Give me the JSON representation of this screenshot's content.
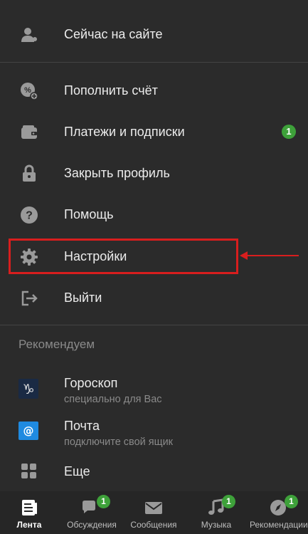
{
  "menu": {
    "online": "Сейчас на сайте",
    "topup": "Пополнить счёт",
    "payments": "Платежи и подписки",
    "payments_badge": "1",
    "privacy": "Закрыть профиль",
    "help": "Помощь",
    "settings": "Настройки",
    "logout": "Выйти"
  },
  "recommend": {
    "title": "Рекомендуем",
    "items": [
      {
        "title": "Гороскоп",
        "subtitle": "специально для Вас",
        "icon": "capricorn-icon"
      },
      {
        "title": "Почта",
        "subtitle": "подключите свой ящик",
        "icon": "mail-icon"
      },
      {
        "title": "Еще",
        "subtitle": "",
        "icon": "grid-icon"
      }
    ]
  },
  "bottom_nav": {
    "items": [
      {
        "label": "Лента",
        "badge": "",
        "active": true
      },
      {
        "label": "Обсуждения",
        "badge": "1"
      },
      {
        "label": "Сообщения",
        "badge": ""
      },
      {
        "label": "Музыка",
        "badge": "1"
      },
      {
        "label": "Рекомендации",
        "badge": "1"
      }
    ]
  },
  "colors": {
    "background": "#2b2b2b",
    "accent_green": "#3ea13a",
    "highlight_red": "#d81e1e"
  }
}
